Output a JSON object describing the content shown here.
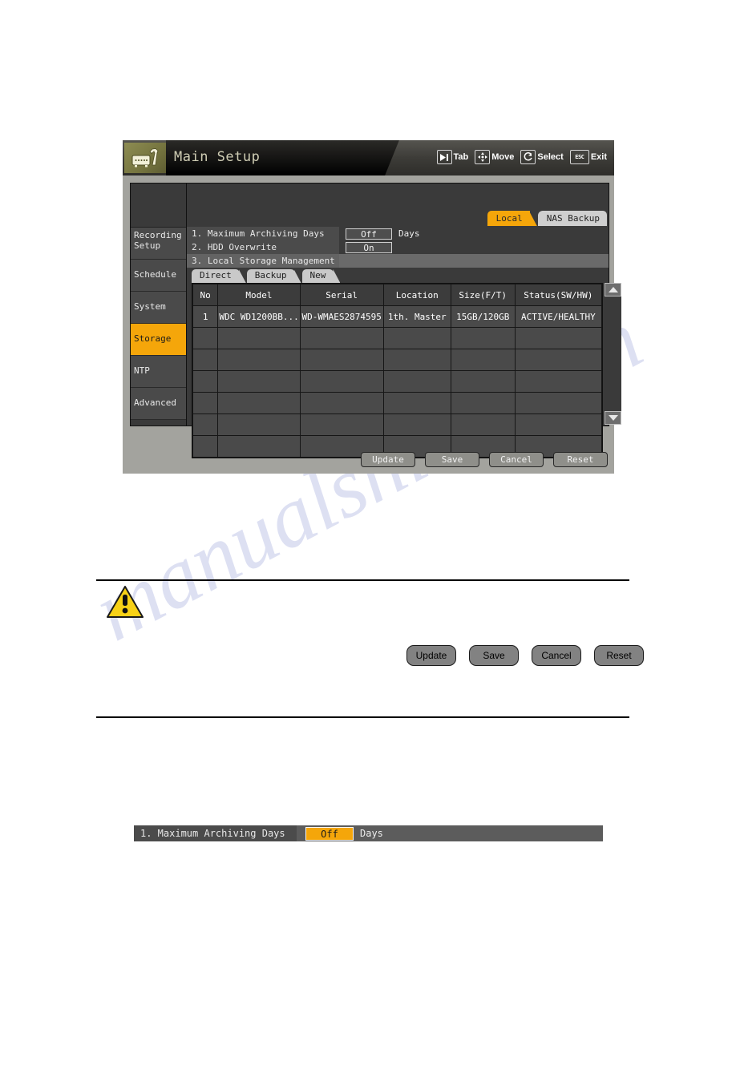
{
  "window": {
    "title": "Main Setup",
    "logo_icon": "router-wrench-icon"
  },
  "hints": [
    {
      "icon": "tab-key-icon",
      "glyph": "▶|",
      "label": "Tab"
    },
    {
      "icon": "dpad-icon",
      "glyph": "✛",
      "label": "Move"
    },
    {
      "icon": "enter-key-icon",
      "glyph": "↵",
      "label": "Select"
    },
    {
      "icon": "esc-key-icon",
      "glyph": "ESC",
      "label": "Exit"
    }
  ],
  "sidebar": {
    "items": [
      {
        "label": "Recording Setup",
        "active": false
      },
      {
        "label": "Schedule",
        "active": false
      },
      {
        "label": "System",
        "active": false
      },
      {
        "label": "Storage",
        "active": true
      },
      {
        "label": "NTP",
        "active": false
      },
      {
        "label": "Advanced",
        "active": false
      }
    ]
  },
  "top_tabs": [
    {
      "label": "Local",
      "active": true
    },
    {
      "label": "NAS Backup",
      "active": false
    }
  ],
  "settings": [
    {
      "index": "1.",
      "label": "1. Maximum Archiving Days",
      "value": "Off",
      "unit": "Days"
    },
    {
      "index": "2.",
      "label": "2. HDD Overwrite",
      "value": "On",
      "unit": ""
    },
    {
      "index": "3.",
      "label": "3. Local Storage Management",
      "value": "",
      "unit": ""
    }
  ],
  "sub_tabs": [
    {
      "label": "Direct"
    },
    {
      "label": "Backup"
    },
    {
      "label": "New"
    }
  ],
  "table": {
    "headers": [
      "No",
      "Model",
      "Serial",
      "Location",
      "Size(F/T)",
      "Status(SW/HW)"
    ],
    "rows": [
      {
        "no": "1",
        "model": "WDC WD1200BB...",
        "serial": "WD-WMAES2874595",
        "location": "1th. Master",
        "size": "15GB/120GB",
        "status": "ACTIVE/HEALTHY"
      }
    ],
    "empty_row_count": 6
  },
  "scroll": {
    "up_icon": "scroll-up-arrow-icon",
    "down_icon": "scroll-down-arrow-icon"
  },
  "panel_buttons": [
    {
      "label": "Update"
    },
    {
      "label": "Save"
    },
    {
      "label": "Cancel"
    },
    {
      "label": "Reset"
    }
  ],
  "note": {
    "warning_icon": "warning-triangle-icon",
    "buttons": [
      {
        "label": "Update"
      },
      {
        "label": "Save"
      },
      {
        "label": "Cancel"
      },
      {
        "label": "Reset"
      }
    ]
  },
  "detail_strip": {
    "label": "1. Maximum Archiving Days",
    "value": "Off",
    "unit": "Days"
  },
  "watermark": {
    "text": "manualshive.com"
  },
  "colors": {
    "accent_orange": "#f5a60a",
    "status_green": "#28e028",
    "panel_gray": "#a3a39e",
    "dark_gray": "#3a3a3a"
  }
}
